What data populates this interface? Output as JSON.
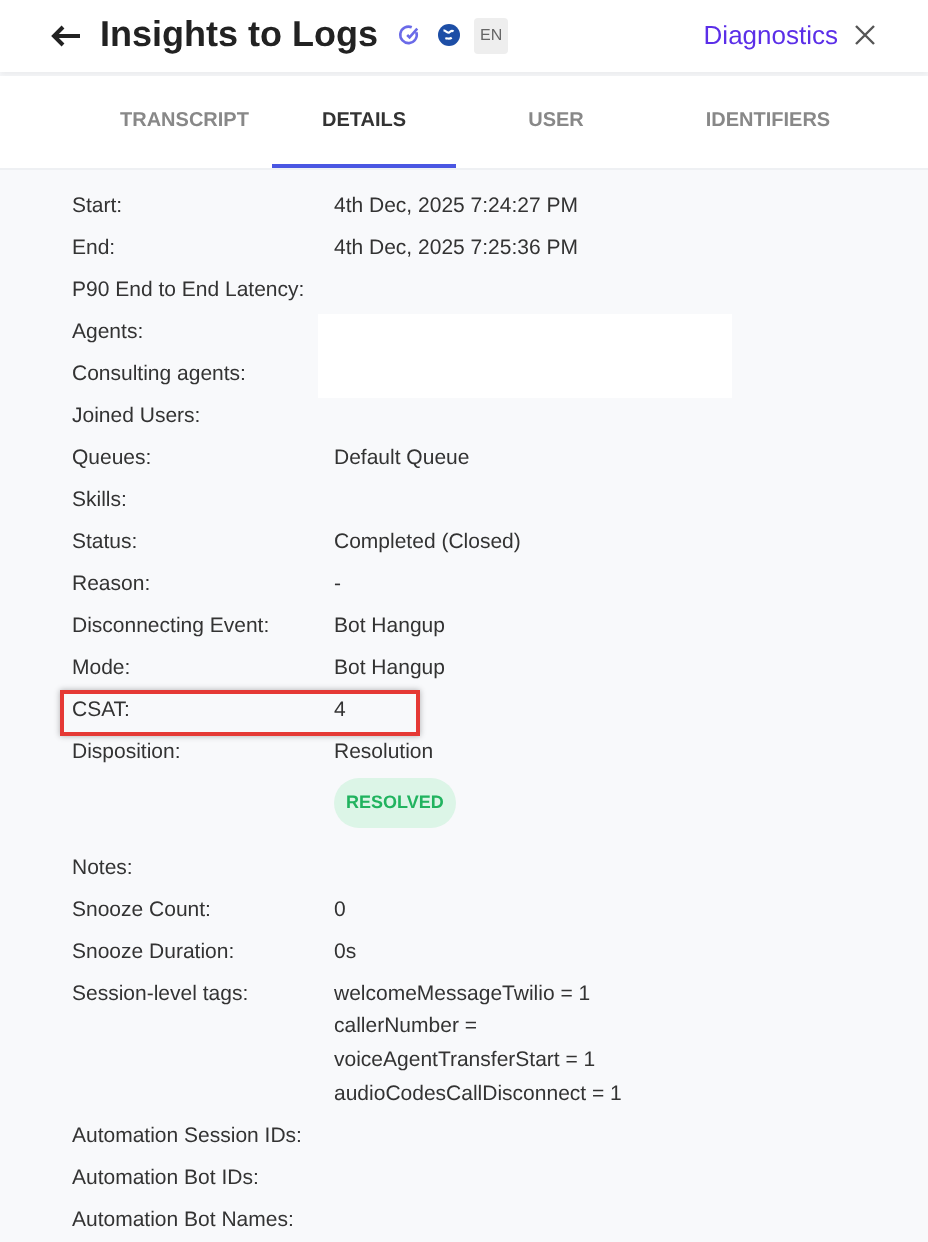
{
  "header": {
    "title": "Insights to Logs",
    "language": "EN",
    "link": "Diagnostics"
  },
  "tabs": [
    {
      "label": "TRANSCRIPT",
      "selected": false
    },
    {
      "label": "DETAILS",
      "selected": true
    },
    {
      "label": "USER",
      "selected": false
    },
    {
      "label": "IDENTIFIERS",
      "selected": false
    }
  ],
  "details": [
    {
      "label": "Start:",
      "value": "4th Dec, 2025 7:24:27 PM"
    },
    {
      "label": "End:",
      "value": "4th Dec, 2025 7:25:36 PM"
    },
    {
      "label": "P90 End to End Latency:"
    },
    {
      "label": "Agents:",
      "redacted": true
    },
    {
      "label": "Consulting agents:",
      "redacted": true
    },
    {
      "label": "Joined Users:"
    },
    {
      "label": "Queues:",
      "value": "Default Queue"
    },
    {
      "label": "Skills:"
    },
    {
      "label": "Status:",
      "value": "Completed (Closed)"
    },
    {
      "label": "Reason:",
      "value": "-"
    },
    {
      "label": "Disconnecting Event:",
      "value": "Bot Hangup"
    },
    {
      "label": "Mode:",
      "value": "Bot Hangup"
    },
    {
      "label": "CSAT:",
      "value": "4",
      "highlighted": true
    },
    {
      "label": "Disposition:",
      "value": "Resolution",
      "badge": "RESOLVED"
    },
    {
      "label": "Notes:"
    },
    {
      "label": "Snooze Count:",
      "value": "0"
    },
    {
      "label": "Snooze Duration:",
      "value": "0s"
    },
    {
      "label": "Session-level tags:",
      "lines": [
        "welcomeMessageTwilio = 1",
        "callerNumber =",
        "voiceAgentTransferStart = 1",
        "audioCodesCallDisconnect = 1"
      ]
    },
    {
      "label": "Automation Session IDs:"
    },
    {
      "label": "Automation Bot IDs:"
    },
    {
      "label": "Automation Bot Names:"
    }
  ]
}
